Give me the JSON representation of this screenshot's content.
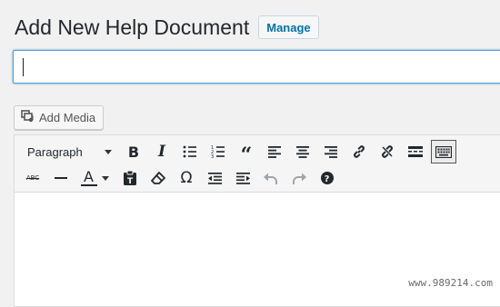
{
  "header": {
    "title": "Add New Help Document",
    "manage_label": "Manage"
  },
  "title_input": {
    "value": ""
  },
  "media": {
    "add_media_label": "Add Media"
  },
  "toolbar": {
    "format_select": "Paragraph",
    "text_color_letter": "A",
    "strikethrough_text": "ABC",
    "row1": [
      "bold-icon",
      "italic-icon",
      "bullet-list-icon",
      "numbered-list-icon",
      "blockquote-icon",
      "align-left-icon",
      "align-center-icon",
      "align-right-icon",
      "link-icon",
      "unlink-icon",
      "read-more-icon",
      "toolbar-toggle-icon"
    ],
    "row2": [
      "strikethrough-icon",
      "horizontal-line-icon",
      "text-color-icon",
      "paste-as-text-icon",
      "clear-formatting-icon",
      "special-character-icon",
      "outdent-icon",
      "indent-icon",
      "undo-icon",
      "redo-icon",
      "help-icon"
    ]
  },
  "footer": {
    "watermark": "www.989214.com"
  },
  "colors": {
    "accent": "#0073aa",
    "focus_border": "#5b9dd9",
    "background": "#f1f1f1"
  }
}
